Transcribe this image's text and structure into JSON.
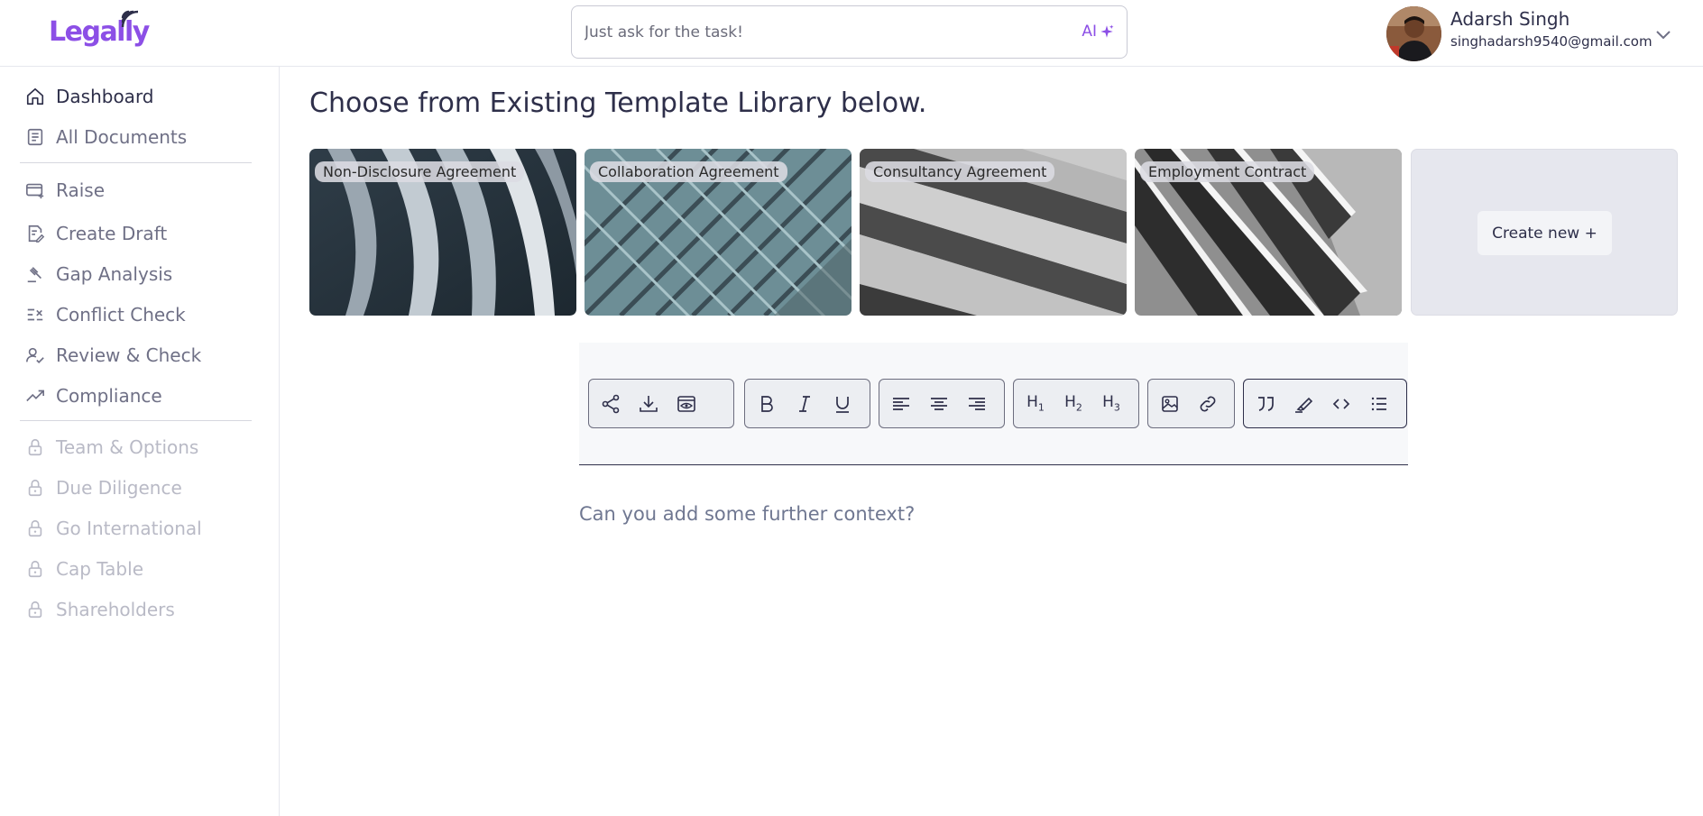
{
  "header": {
    "logo_text": "Legally",
    "search_placeholder": "Just ask for the task!",
    "ai_label": "AI",
    "user_name": "Adarsh Singh",
    "user_email": "singhadarsh9540@gmail.com"
  },
  "sidebar": {
    "items": [
      {
        "label": "Dashboard",
        "state": "active",
        "icon": "home-icon"
      },
      {
        "label": "All Documents",
        "state": "normal",
        "icon": "document-icon"
      },
      {
        "label": "Raise",
        "state": "normal",
        "icon": "card-plus-icon"
      },
      {
        "label": "Create Draft",
        "state": "normal",
        "icon": "edit-document-icon"
      },
      {
        "label": "Gap Analysis",
        "state": "normal",
        "icon": "gavel-icon"
      },
      {
        "label": "Conflict Check",
        "state": "normal",
        "icon": "list-check-icon"
      },
      {
        "label": "Review & Check",
        "state": "normal",
        "icon": "user-check-icon"
      },
      {
        "label": "Compliance",
        "state": "normal",
        "icon": "trend-icon"
      },
      {
        "label": "Team & Options",
        "state": "locked",
        "icon": "lock-icon"
      },
      {
        "label": "Due Diligence",
        "state": "locked",
        "icon": "lock-icon"
      },
      {
        "label": "Go International",
        "state": "locked",
        "icon": "lock-icon"
      },
      {
        "label": "Cap Table",
        "state": "locked",
        "icon": "lock-icon"
      },
      {
        "label": "Shareholders",
        "state": "locked",
        "icon": "lock-icon"
      }
    ]
  },
  "main": {
    "heading": "Choose from Existing Template Library below.",
    "templates": [
      {
        "label": "Non-Disclosure Agreement"
      },
      {
        "label": "Collaboration Agreement"
      },
      {
        "label": "Consultancy Agreement"
      },
      {
        "label": "Employment Contract"
      }
    ],
    "create_new_label": "Create new +",
    "context_placeholder": "Can you add some further context?"
  },
  "toolbar": {
    "groups": [
      [
        "share-icon",
        "download-icon",
        "preview-icon"
      ],
      [
        "bold-icon",
        "italic-icon",
        "underline-icon"
      ],
      [
        "align-left-icon",
        "align-center-icon",
        "align-right-icon"
      ],
      [
        "heading-1-icon",
        "heading-2-icon",
        "heading-3-icon"
      ],
      [
        "image-icon",
        "link-icon"
      ],
      [
        "quote-icon",
        "highlight-icon",
        "code-icon",
        "bullet-list-icon"
      ]
    ]
  },
  "colors": {
    "brand": "#8c4fe6",
    "text": "#2e2f4a",
    "muted": "#6f7086",
    "locked": "#b9bac6"
  }
}
